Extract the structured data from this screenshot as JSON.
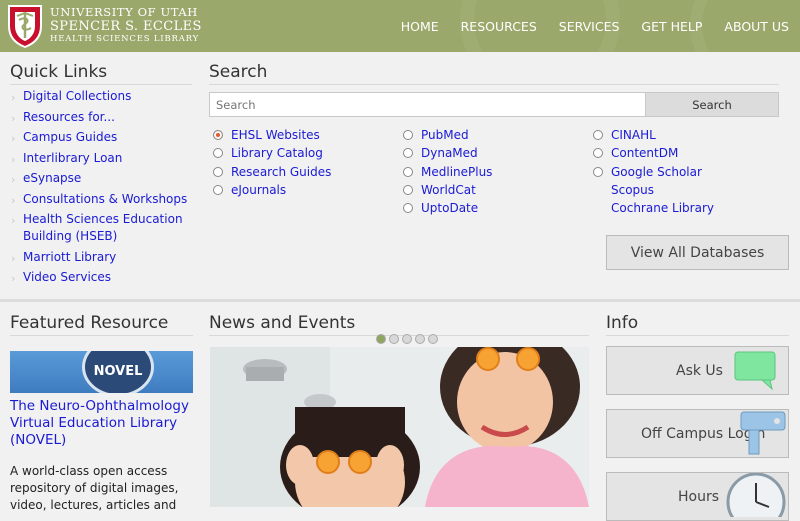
{
  "header": {
    "logo_line1": "UNIVERSITY OF UTAH",
    "logo_line2": "SPENCER S. ECCLES",
    "logo_line3": "HEALTH SCIENCES LIBRARY",
    "nav": [
      "HOME",
      "RESOURCES",
      "SERVICES",
      "GET HELP",
      "ABOUT US"
    ]
  },
  "quick_links": {
    "title": "Quick Links",
    "items": [
      "Digital Collections",
      "Resources for...",
      "Campus Guides",
      "Interlibrary Loan",
      "eSynapse",
      "Consultations & Workshops",
      "Health Sciences Education Building (HSEB)",
      "Marriott Library",
      "Video Services"
    ]
  },
  "search": {
    "title": "Search",
    "placeholder": "Search",
    "button": "Search",
    "col1": [
      "EHSL Websites",
      "Library Catalog",
      "Research Guides",
      "eJournals"
    ],
    "col2": [
      "PubMed",
      "DynaMed",
      "MedlinePlus",
      "WorldCat",
      "UptoDate"
    ],
    "col3": [
      "CINAHL",
      "ContentDM",
      "Google Scholar"
    ],
    "col3_links": [
      "Scopus",
      "Cochrane Library"
    ],
    "view_all": "View All Databases"
  },
  "featured": {
    "title": "Featured Resource",
    "badge": "NOVEL",
    "resource_title": "The Neuro-Ophthalmology Virtual Education Library (NOVEL)",
    "description": "A world-class open access repository of digital images, video, lectures, articles and"
  },
  "news": {
    "title": "News and Events",
    "slide_count": 5,
    "active_slide": 1
  },
  "info": {
    "title": "Info",
    "buttons": [
      "Ask Us",
      "Off Campus Login",
      "Hours"
    ]
  },
  "colors": {
    "header": "#9aa86b",
    "link": "#1a1ad4",
    "radio_selected": "#e05a2a"
  }
}
